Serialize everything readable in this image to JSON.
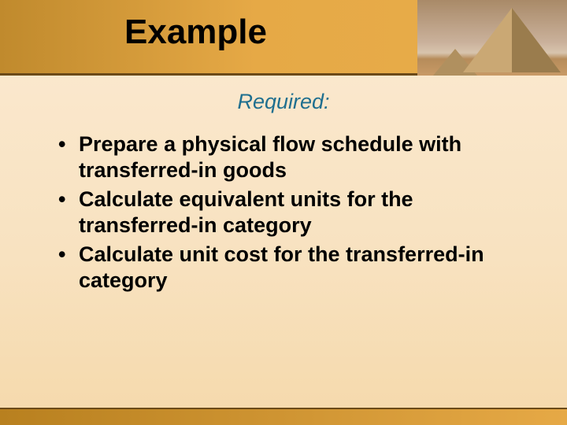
{
  "title": "Example",
  "subtitle": "Required:",
  "bullets": [
    "Prepare a physical flow schedule with transferred-in goods",
    "Calculate equivalent units for the transferred-in category",
    "Calculate unit cost for the transferred-in category"
  ]
}
